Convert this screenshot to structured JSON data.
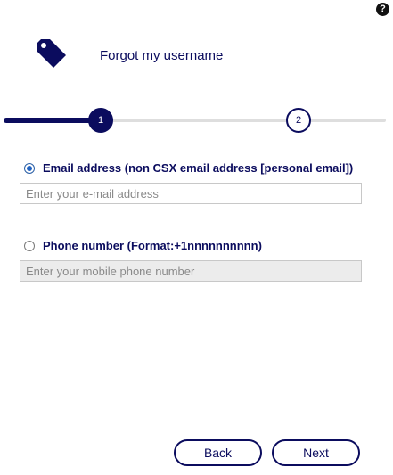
{
  "header": {
    "help_glyph": "?",
    "title": "Forgot my username",
    "title_icon": "tag-icon"
  },
  "stepper": {
    "steps": [
      {
        "label": "1",
        "state": "active"
      },
      {
        "label": "2",
        "state": "upcoming"
      }
    ],
    "progress_fraction": 0.25
  },
  "options": {
    "email": {
      "label": "Email address (non CSX email address [personal email])",
      "selected": true,
      "placeholder": "Enter your e-mail address",
      "value": ""
    },
    "phone": {
      "label": "Phone number (Format:+1nnnnnnnnnn)",
      "selected": false,
      "placeholder": "Enter your mobile phone number",
      "value": ""
    }
  },
  "buttons": {
    "back": "Back",
    "next": "Next"
  },
  "colors": {
    "primary": "#0b0c5e",
    "track": "#dedede",
    "radio_selected": "#1f62c2",
    "disabled_field": "#ececec"
  }
}
